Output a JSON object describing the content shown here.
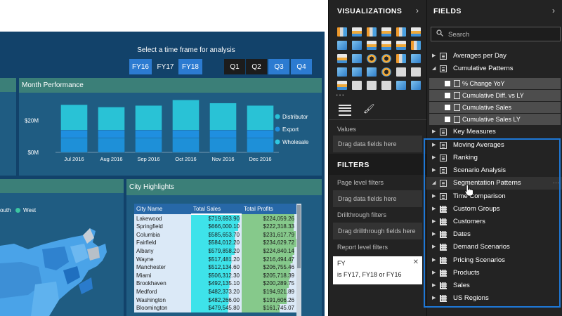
{
  "report": {
    "prompt": "Select a time frame for analysis",
    "fy_buttons": [
      "FY16",
      "FY17",
      "FY18"
    ],
    "q_buttons": [
      "Q1",
      "Q2",
      "Q3",
      "Q4"
    ],
    "month_panel_title": "Month Performance",
    "city_panel_title": "City Highlights",
    "map_legend": {
      "prefix": "outh",
      "west": "West"
    }
  },
  "chart_data": {
    "type": "bar",
    "stacked": true,
    "categories": [
      "Jul 2016",
      "Aug 2016",
      "Sep 2016",
      "Oct 2016",
      "Nov 2016",
      "Dec 2016"
    ],
    "series": [
      {
        "name": "Wholesale",
        "color": "#1e90d8",
        "values": [
          9,
          9,
          9,
          9,
          9,
          9
        ]
      },
      {
        "name": "Export",
        "color": "#1f8fe0",
        "values": [
          5,
          5,
          5,
          5,
          5,
          5
        ]
      },
      {
        "name": "Distributor",
        "color": "#29c2d6",
        "values": [
          16,
          14.5,
          15.5,
          19,
          17,
          15.5
        ]
      }
    ],
    "ytick_labels": [
      "$0M",
      "$20M"
    ],
    "yticks": [
      0,
      20
    ],
    "ylim": [
      0,
      34
    ],
    "legend": "right",
    "grid": false
  },
  "city_table": {
    "headers": [
      "City Name",
      "Total Sales",
      "Total Profits"
    ],
    "rows": [
      {
        "city": "Lakewood",
        "sales": "$719,693.90",
        "profit": "$224,059.26",
        "sales_ratio": 0.96,
        "profit_ratio": 0.96
      },
      {
        "city": "Springfield",
        "sales": "$666,000.10",
        "profit": "$222,318.33",
        "sales_ratio": 0.93,
        "profit_ratio": 0.95
      },
      {
        "city": "Columbia",
        "sales": "$585,653.70",
        "profit": "$231,617.79",
        "sales_ratio": 0.87,
        "profit_ratio": 0.99
      },
      {
        "city": "Fairfield",
        "sales": "$584,012.20",
        "profit": "$234,629.72",
        "sales_ratio": 0.87,
        "profit_ratio": 1.0
      },
      {
        "city": "Albany",
        "sales": "$579,858.20",
        "profit": "$224,840.14",
        "sales_ratio": 0.86,
        "profit_ratio": 0.96
      },
      {
        "city": "Wayne",
        "sales": "$517,481.20",
        "profit": "$216,494.47",
        "sales_ratio": 0.8,
        "profit_ratio": 0.93
      },
      {
        "city": "Manchester",
        "sales": "$512,134.60",
        "profit": "$206,755.46",
        "sales_ratio": 0.79,
        "profit_ratio": 0.89
      },
      {
        "city": "Miami",
        "sales": "$506,312.30",
        "profit": "$205,718.39",
        "sales_ratio": 0.78,
        "profit_ratio": 0.88
      },
      {
        "city": "Brookhaven",
        "sales": "$492,135.10",
        "profit": "$200,289.75",
        "sales_ratio": 0.76,
        "profit_ratio": 0.86
      },
      {
        "city": "Medford",
        "sales": "$482,373.20",
        "profit": "$194,921.89",
        "sales_ratio": 0.74,
        "profit_ratio": 0.83
      },
      {
        "city": "Washington",
        "sales": "$482,266.00",
        "profit": "$191,606.26",
        "sales_ratio": 0.74,
        "profit_ratio": 0.82
      },
      {
        "city": "Bloomington",
        "sales": "$479,545.80",
        "profit": "$161,745.07",
        "sales_ratio": 0.73,
        "profit_ratio": 0.69
      }
    ]
  },
  "viz": {
    "title": "VISUALIZATIONS",
    "more": "...",
    "values_label": "Values",
    "drag_fields": "Drag data fields here",
    "filters_title": "FILTERS",
    "page_filters": "Page level filters",
    "drag_fields_2": "Drag data fields here",
    "drillthrough": "Drillthrough filters",
    "drag_drill": "Drag drillthrough fields here",
    "report_filters": "Report level filters",
    "filter_card": {
      "name": "FY",
      "desc": "is FY17, FY18 or FY16"
    }
  },
  "fields": {
    "title": "FIELDS",
    "search_placeholder": "Search",
    "rows": [
      {
        "label": "Averages per Day",
        "icon": "folder",
        "caret": "▶"
      },
      {
        "label": "Cumulative Patterns",
        "icon": "folder",
        "caret": "◢"
      }
    ],
    "sub": [
      "% Change YoY",
      "Cumulative Diff. vs LY",
      "Cumulative Sales",
      "Cumulative Sales LY"
    ],
    "rows2": [
      {
        "label": "Key Measures",
        "icon": "folder"
      },
      {
        "label": "Moving Averages",
        "icon": "folder"
      },
      {
        "label": "Ranking",
        "icon": "folder"
      },
      {
        "label": "Scenario Analysis",
        "icon": "folder"
      },
      {
        "label": "Segmentation Patterns",
        "icon": "folder"
      },
      {
        "label": "Time Comparison",
        "icon": "folder"
      },
      {
        "label": "Custom Groups",
        "icon": "table"
      },
      {
        "label": "Customers",
        "icon": "table"
      },
      {
        "label": "Dates",
        "icon": "table"
      },
      {
        "label": "Demand Scenarios",
        "icon": "table"
      },
      {
        "label": "Pricing Scenarios",
        "icon": "table"
      },
      {
        "label": "Products",
        "icon": "table"
      },
      {
        "label": "Sales",
        "icon": "table"
      },
      {
        "label": "US Regions",
        "icon": "table"
      }
    ]
  }
}
